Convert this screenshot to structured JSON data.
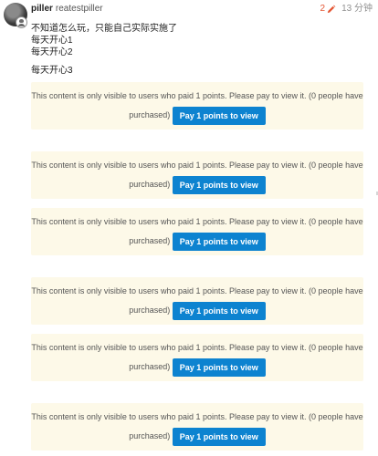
{
  "post": {
    "author": {
      "username": "piller",
      "full_name": "reatestpiller",
      "avatar_icon": "user-avatar",
      "badge_icon": "user-badge-icon"
    },
    "meta": {
      "edit_count": "2",
      "edit_icon": "pencil-icon",
      "edit_color": "#e45735",
      "post_age": "13 分钟"
    },
    "body": {
      "lines": [
        "不知道怎么玩，只能自己实际实施了",
        "每天开心1",
        "每天开心2",
        "每天开心3"
      ]
    },
    "paywall": {
      "message": "This content is only visible to users who paid 1 points. Please pay to view it. (0 people have purchased)",
      "button_label": "Pay 1 points to view",
      "background": "#fdf9e8",
      "button_color": "#0d83d0",
      "count": 6
    }
  }
}
